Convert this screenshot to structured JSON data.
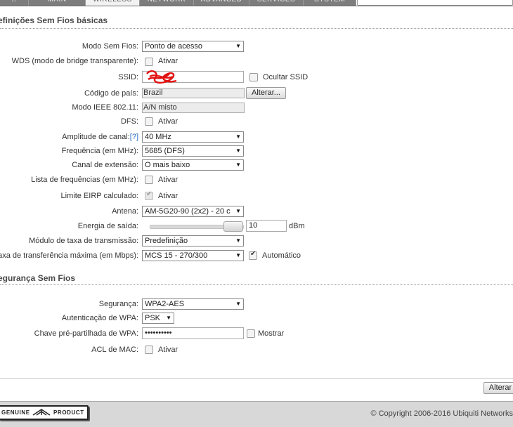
{
  "nav": {
    "tabs": [
      {
        "label": "⌂",
        "active": false
      },
      {
        "label": "MAIN",
        "active": false
      },
      {
        "label": "WIRELESS",
        "active": true
      },
      {
        "label": "NETWORK",
        "active": false
      },
      {
        "label": "ADVANCED",
        "active": false
      },
      {
        "label": "SERVICES",
        "active": false
      },
      {
        "label": "SYSTEM",
        "active": false
      }
    ]
  },
  "basic": {
    "title": "efinições Sem Fios básicas",
    "wireless_mode": {
      "label": "Modo Sem Fios:",
      "value": "Ponto de acesso"
    },
    "wds": {
      "label": "WDS (modo de bridge transparente):",
      "option": "Ativar",
      "checked": false
    },
    "ssid": {
      "label": "SSID:",
      "hide_label": "Ocultar SSID",
      "hide_checked": false
    },
    "country": {
      "label": "Código de país:",
      "value": "Brazil",
      "button": "Alterar..."
    },
    "ieee": {
      "label": "Modo IEEE 802.11:",
      "value": "A/N misto"
    },
    "dfs": {
      "label": "DFS:",
      "option": "Ativar",
      "checked": false
    },
    "channel_width": {
      "label": "Amplitude de canal:",
      "help": "[?]",
      "value": "40 MHz"
    },
    "frequency": {
      "label": "Frequência (em MHz):",
      "value": "5685 (DFS)"
    },
    "ext_channel": {
      "label": "Canal de extensão:",
      "value": "O mais baixo"
    },
    "freq_list": {
      "label": "Lista de frequências (em MHz):",
      "option": "Ativar",
      "checked": false
    },
    "eirp": {
      "label": "Limite EIRP calculado:",
      "option": "Ativar",
      "checked": true
    },
    "antenna": {
      "label": "Antena:",
      "value": "AM-5G20-90 (2x2) - 20 c"
    },
    "output_power": {
      "label": "Energia de saída:",
      "value": "10",
      "unit": "dBm",
      "slider_level_percent": 88
    },
    "rate_module": {
      "label": "Módulo de taxa de transmissão:",
      "value": "Predefinição"
    },
    "max_rate": {
      "label": "axa de transferência máxima (em Mbps):",
      "value": "MCS 15 - 270/300",
      "auto_label": "Automático",
      "auto_checked": true
    }
  },
  "security": {
    "title": "egurança Sem Fios",
    "security": {
      "label": "Segurança:",
      "value": "WPA2-AES"
    },
    "wpa_auth": {
      "label": "Autenticação de WPA:",
      "value": "PSK"
    },
    "psk": {
      "label": "Chave pré-partilhada de WPA:",
      "value": "••••••••••",
      "show_label": "Mostrar",
      "show_checked": false
    },
    "mac_acl": {
      "label": "ACL de MAC:",
      "option": "Ativar",
      "checked": false
    }
  },
  "actions": {
    "change_button": "Alterar"
  },
  "footer": {
    "logo_left": "GENUINE",
    "logo_right": "PRODUCT",
    "copyright": "© Copyright 2006-2016 Ubiquiti Networks"
  }
}
